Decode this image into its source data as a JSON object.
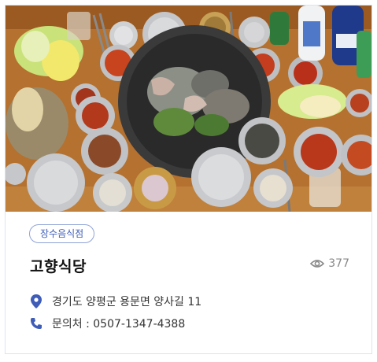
{
  "restaurant": {
    "category": "장수음식점",
    "name": "고향식당",
    "views": "377",
    "address": "경기도 양평군 용문면 양사길 11",
    "phone": "문의처 : 0507-1347-4388"
  },
  "icons": {
    "views": "eye-icon",
    "address": "location-pin-icon",
    "phone": "phone-icon"
  },
  "colors": {
    "badge_border": "#8fa3d6",
    "badge_text": "#3f5db8",
    "icon_blue": "#3f5db8"
  }
}
